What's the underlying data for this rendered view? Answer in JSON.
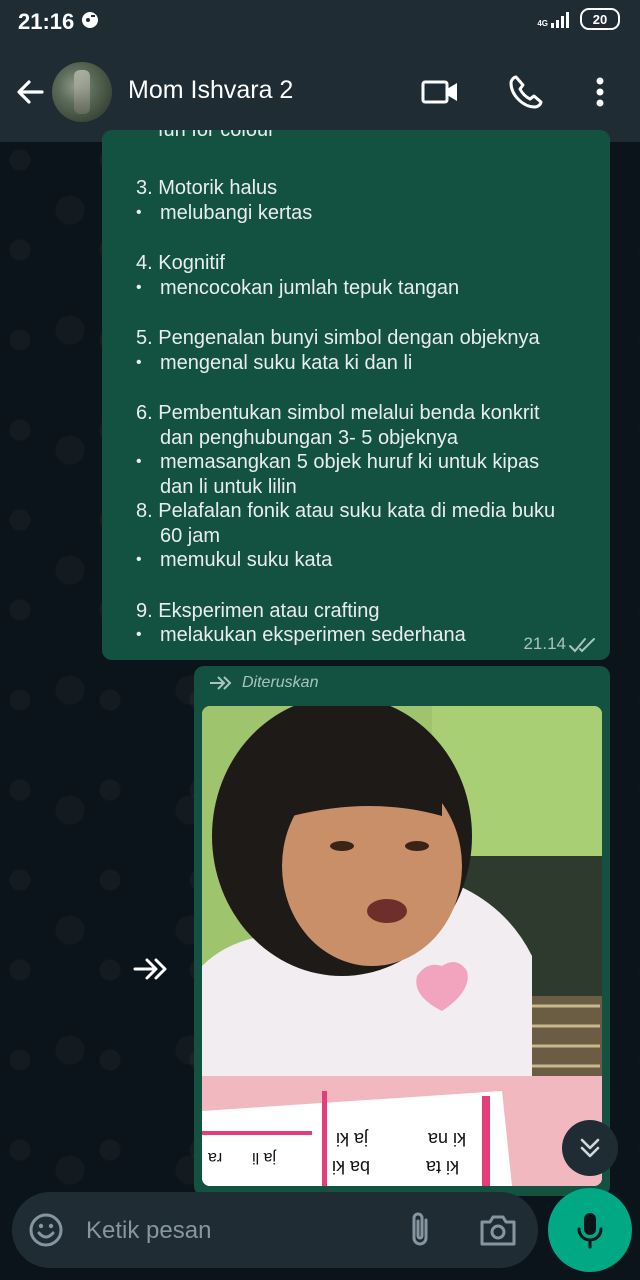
{
  "status_bar": {
    "time": "21:16",
    "network": "4G",
    "battery": "20"
  },
  "header": {
    "contact_name": "Mom Ishvara 2"
  },
  "message1": {
    "cut_top_line": "fun for colour",
    "lines": [
      {
        "type": "gap"
      },
      {
        "type": "num",
        "text": "3. Motorik halus"
      },
      {
        "type": "bul",
        "text": "melubangi kertas"
      },
      {
        "type": "gap"
      },
      {
        "type": "num",
        "text": "4. Kognitif"
      },
      {
        "type": "bul",
        "text": "mencocokan jumlah tepuk tangan"
      },
      {
        "type": "gap"
      },
      {
        "type": "num",
        "text": "5. Pengenalan bunyi simbol dengan objeknya"
      },
      {
        "type": "bul",
        "text": "mengenal suku kata ki dan li"
      },
      {
        "type": "gap"
      },
      {
        "type": "num",
        "text": "6. Pembentukan simbol melalui benda konkrit"
      },
      {
        "type": "cont",
        "text": "dan penghubungan 3- 5 objeknya"
      },
      {
        "type": "bul",
        "text": "memasangkan 5 objek huruf ki untuk kipas"
      },
      {
        "type": "cont",
        "text": "dan li untuk lilin"
      },
      {
        "type": "num",
        "text": "8. Pelafalan fonik atau suku kata di media buku"
      },
      {
        "type": "cont",
        "text": "60 jam"
      },
      {
        "type": "bul",
        "text": "memukul suku kata"
      },
      {
        "type": "gap"
      },
      {
        "type": "num",
        "text": "9. Eksperimen atau crafting"
      },
      {
        "type": "bul",
        "text": "melakukan eksperimen sederhana"
      }
    ],
    "time": "21.14"
  },
  "message2": {
    "forwarded_label": "Diteruskan",
    "book_text": [
      "ki ta",
      "ba ki",
      "ja ki",
      "ki na",
      "ja li",
      "ra"
    ]
  },
  "input": {
    "placeholder": "Ketik pesan"
  },
  "icons": {
    "back": "arrow-back-icon",
    "video": "video-call-icon",
    "phone": "phone-call-icon",
    "menu": "more-vert-icon",
    "emoji": "emoji-icon",
    "attach": "paperclip-icon",
    "camera": "camera-icon",
    "mic": "mic-icon",
    "forward": "forward-icon",
    "scroll": "double-chevron-down-icon"
  },
  "colors": {
    "accent": "#00a884",
    "bubble": "#135240",
    "background": "#0b141a",
    "header": "#1f2c34"
  }
}
